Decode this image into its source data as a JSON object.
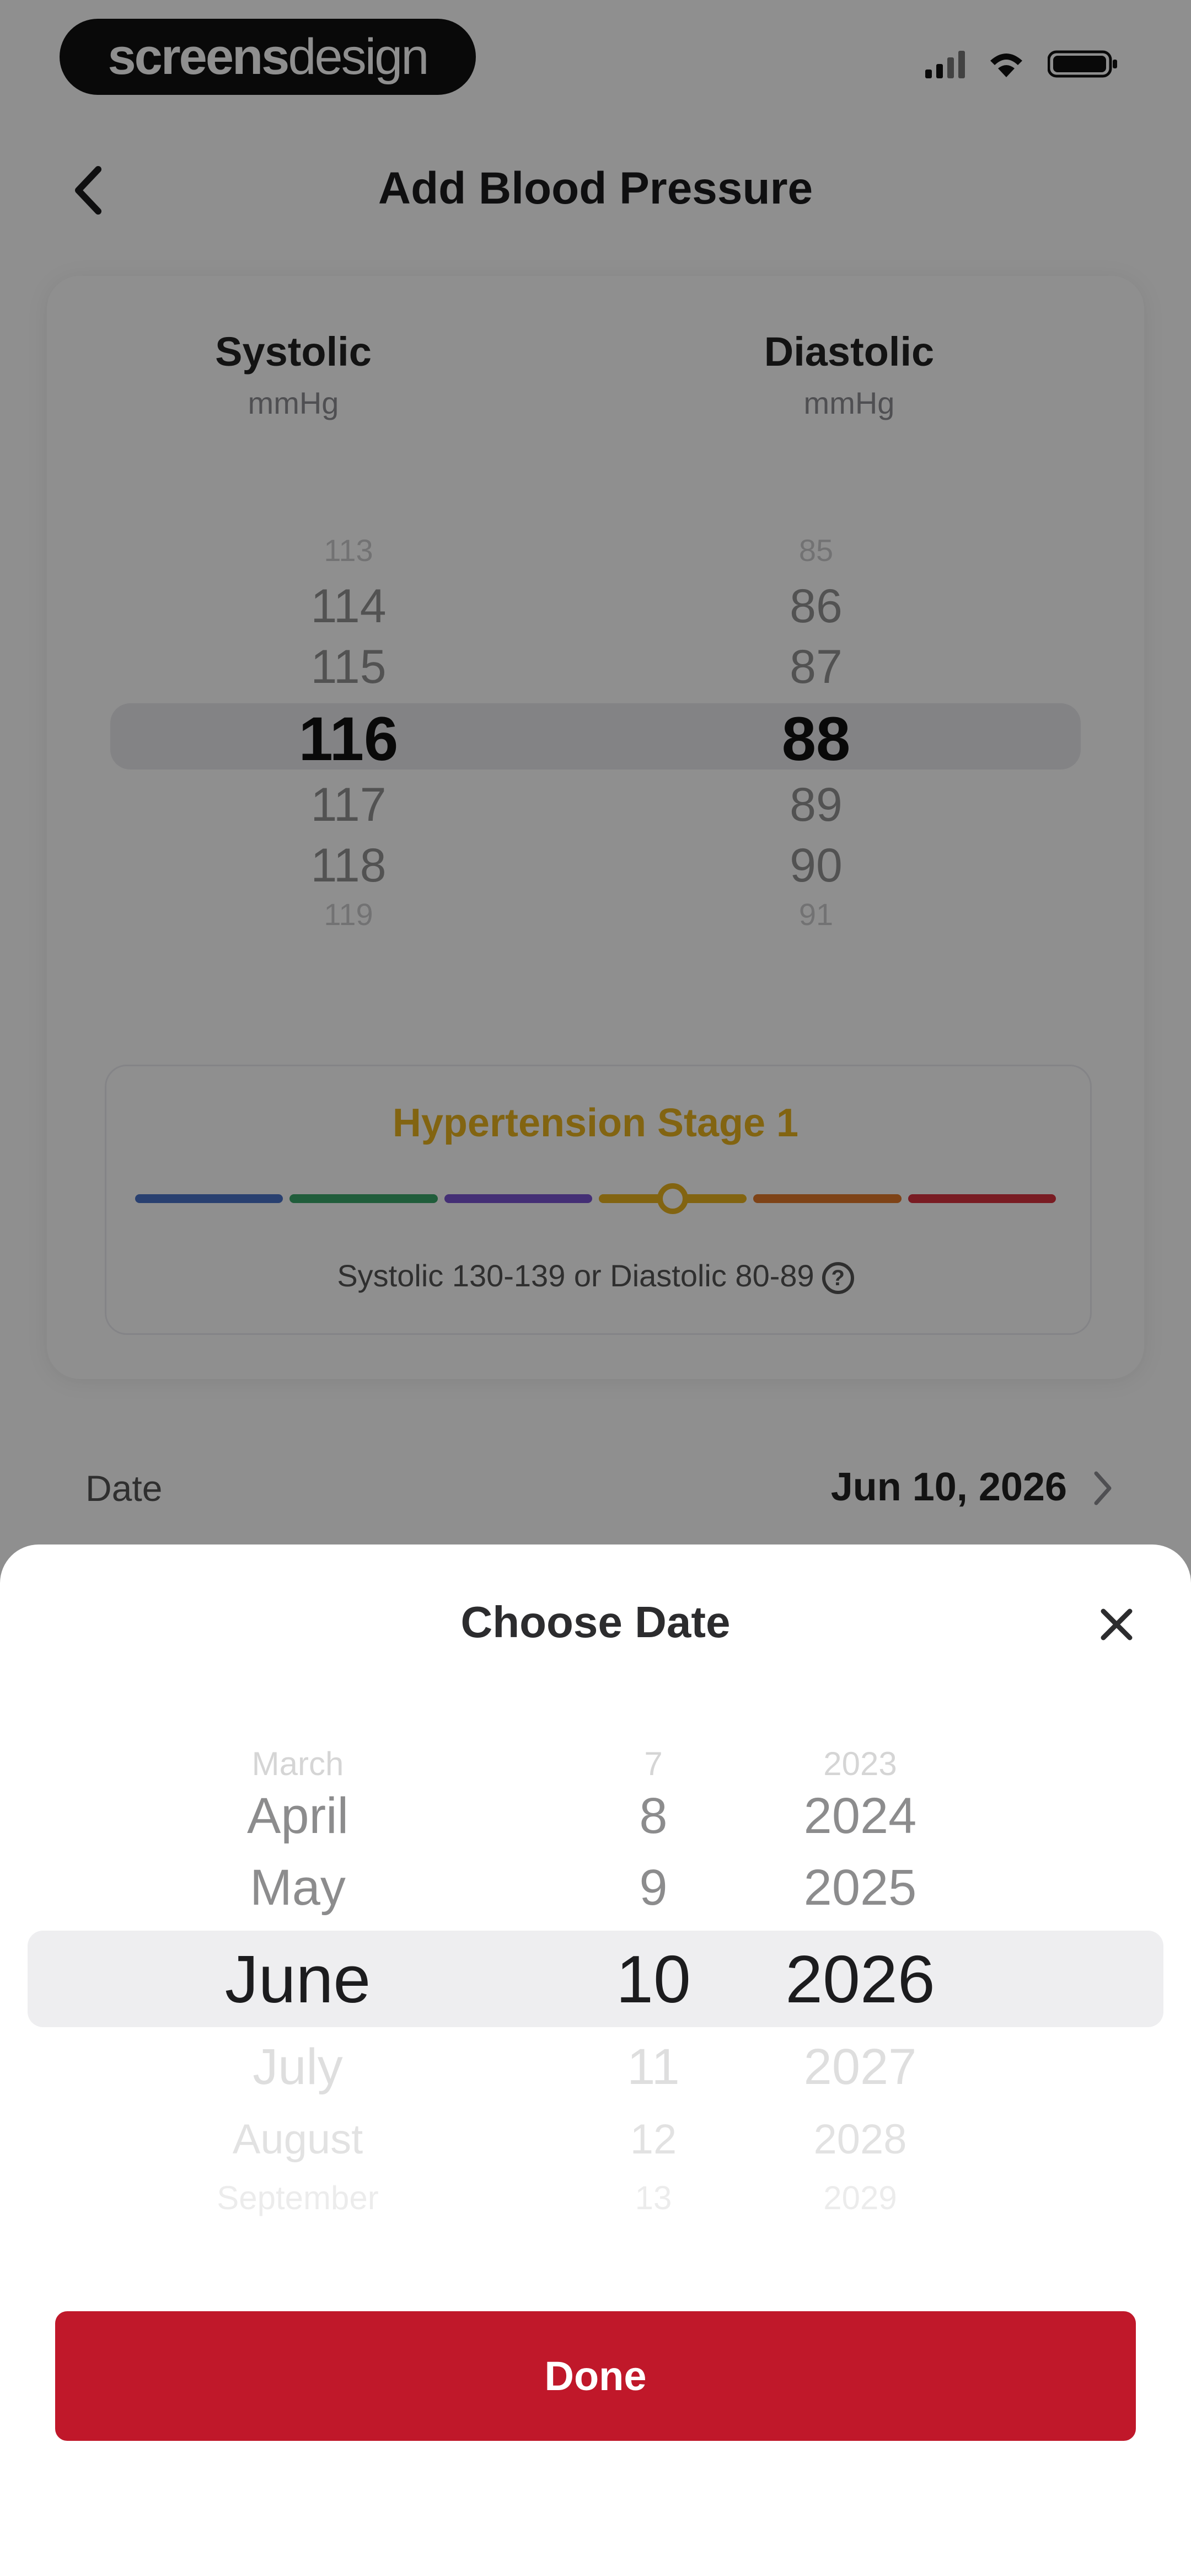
{
  "status_bar": {
    "badge_part1": "screens",
    "badge_part2": "design"
  },
  "header": {
    "title": "Add Blood Pressure"
  },
  "systolic": {
    "label": "Systolic",
    "unit": "mmHg",
    "values": [
      "113",
      "114",
      "115",
      "116",
      "117",
      "118",
      "119"
    ],
    "selected": "116"
  },
  "diastolic": {
    "label": "Diastolic",
    "unit": "mmHg",
    "values": [
      "85",
      "86",
      "87",
      "88",
      "89",
      "90",
      "91"
    ],
    "selected": "88"
  },
  "stage": {
    "title": "Hypertension Stage 1",
    "description": "Systolic 130-139 or Diastolic 80-89",
    "scale_colors": [
      "#4a72c8",
      "#3aa66a",
      "#7a55d1",
      "#e8b21f",
      "#e0782a",
      "#d8333f"
    ],
    "active_index": 3,
    "accent": "#e8b21f"
  },
  "date_row": {
    "label": "Date",
    "value": "Jun 10, 2026"
  },
  "date_sheet": {
    "title": "Choose Date",
    "months": [
      "March",
      "April",
      "May",
      "June",
      "July",
      "August",
      "September"
    ],
    "days": [
      "7",
      "8",
      "9",
      "10",
      "11",
      "12",
      "13"
    ],
    "years": [
      "2023",
      "2024",
      "2025",
      "2026",
      "2027",
      "2028",
      "2029"
    ],
    "selected": {
      "month": "June",
      "day": "10",
      "year": "2026"
    },
    "done_label": "Done",
    "done_color": "#c0182a"
  }
}
